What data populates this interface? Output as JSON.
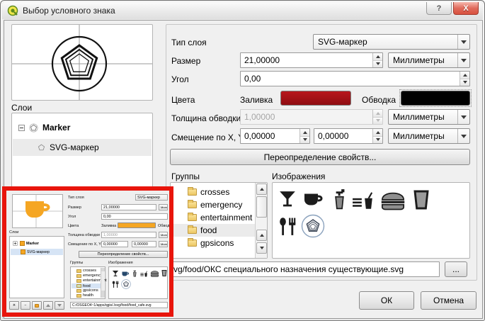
{
  "window": {
    "title": "Выбор условного знака",
    "help_glyph": "?",
    "close_glyph": "X"
  },
  "layers_panel": {
    "label": "Слои",
    "root_item": "Marker",
    "child_item": "SVG-маркер"
  },
  "form": {
    "type_label": "Тип слоя",
    "type_value": "SVG-маркер",
    "size_label": "Размер",
    "size_value": "21,00000",
    "unit_mm": "Миллиметры",
    "angle_label": "Угол",
    "angle_value": "0,00",
    "colors_label": "Цвета",
    "fill_label": "Заливка",
    "stroke_label": "Обводка",
    "stroke_width_label": "Толщина обводки",
    "stroke_width_value": "1,00000",
    "offset_label": "Смещение по X, Y",
    "offset_x": "0,00000",
    "offset_y": "0,00000",
    "override_button": "Переопределение свойств...",
    "groups_label": "Группы",
    "images_label": "Изображения",
    "path_value": "vg/food/ОКС специального назначения существующие.svg",
    "browse_button": "..."
  },
  "groups": {
    "items": [
      "crosses",
      "emergency",
      "entertainment",
      "food",
      "gpsicons"
    ],
    "selected": "food"
  },
  "images_panel": {
    "icons": [
      "martini-glass",
      "coffee-cup",
      "drinking-water",
      "fast-food",
      "hamburger",
      "drink-glass",
      "cutlery",
      "pentagon-svg-marker"
    ],
    "selected": "pentagon-svg-marker"
  },
  "dialog_buttons": {
    "ok": "ОК",
    "cancel": "Отмена"
  },
  "colors": {
    "fill_red": "#a31118",
    "stroke_black": "#000000",
    "symbol_orange": "#f5a623",
    "highlight_red": "#e8150c"
  },
  "inset": {
    "layers_label": "Слои",
    "root_item": "Marker",
    "child_item": "SVG-маркер",
    "form": {
      "type_label": "Тип слоя",
      "type_value": "SVG-маркер",
      "size_label": "Размер",
      "size_value": "21,00000",
      "angle_label": "Угол",
      "angle_value": "0,00",
      "colors_label": "Цвета",
      "fill_label": "Заливка",
      "stroke_label": "Обводка",
      "stroke_width_label": "Толщина обводки",
      "stroke_width_value": "1,00000",
      "offset_label": "Смещение по X, Y",
      "offset_x": "0,00000",
      "offset_y": "0,00000",
      "unit_mm": "Миллиметры",
      "override_button": "Переопределение свойств...",
      "groups_label": "Группы",
      "images_label": "Изображения",
      "path_value": "C:/OSGEO4~1/apps/qgis/./svg/food/food_cafe.svg"
    },
    "groups_items": [
      "crosses",
      "emergency",
      "entertainment",
      "food",
      "gpsicons",
      "health"
    ],
    "groups_selected": "food"
  }
}
